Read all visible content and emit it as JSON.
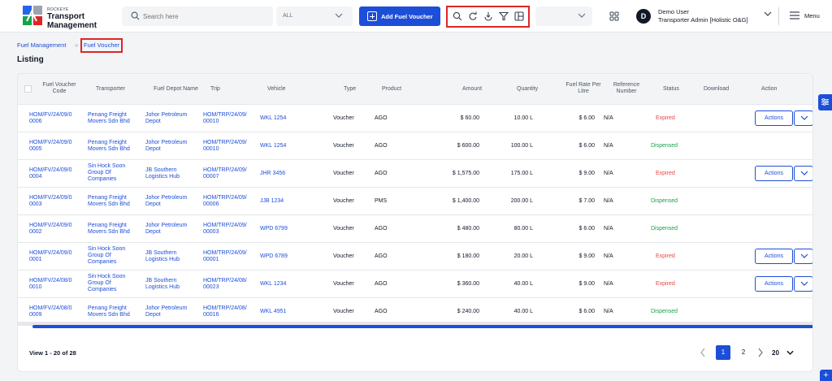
{
  "app": {
    "brand": "ROCKEYE",
    "title_line1": "Transport",
    "title_line2": "Management"
  },
  "header": {
    "search_placeholder": "Search here",
    "filter_value": "ALL",
    "add_button_label": "Add Fuel Voucher",
    "empty_select_value": "",
    "user_name": "Demo User",
    "user_role": "Transporter Admin [Holistic O&G]",
    "avatar_initial": "D",
    "menu_label": "Menu",
    "toolbar_icons": [
      "search-icon",
      "refresh-icon",
      "download-icon",
      "filter-icon",
      "columns-icon"
    ]
  },
  "breadcrumb": {
    "root": "Fuel Management",
    "separator": "»",
    "current": "Fuel Voucher"
  },
  "page_title": "Listing",
  "table": {
    "columns": {
      "code_line1": "Fuel Voucher",
      "code_line2": "Code",
      "transporter": "Transporter",
      "depot": "Fuel Depot Name",
      "trip": "Trip",
      "vehicle": "Vehicle",
      "type": "Type",
      "product": "Product",
      "amount": "Amount",
      "quantity": "Quantity",
      "rate_line1": "Fuel Rate Per",
      "rate_line2": "Litre",
      "ref_line1": "Reference",
      "ref_line2": "Number",
      "status": "Status",
      "download": "Download",
      "action": "Action"
    },
    "rows": [
      {
        "code1": "HOM/FV/24/09/0",
        "code2": "0006",
        "tr1": "Penang Freight",
        "tr2": "Movers Sdn Bhd",
        "tr3": "",
        "dp1": "Johor Petroleum",
        "dp2": "Depot",
        "trip1": "HOM/TRP/24/09/",
        "trip2": "00010",
        "vehicle": "WKL 1254",
        "type": "Voucher",
        "product": "AGO",
        "amount": "$ 60.00",
        "quantity": "10.00 L",
        "rate": "$ 6.00",
        "ref": "N/A",
        "status": "Expired",
        "action": "Actions"
      },
      {
        "code1": "HOM/FV/24/09/0",
        "code2": "0005",
        "tr1": "Penang Freight",
        "tr2": "Movers Sdn Bhd",
        "tr3": "",
        "dp1": "Johor Petroleum",
        "dp2": "Depot",
        "trip1": "HOM/TRP/24/09/",
        "trip2": "00010",
        "vehicle": "WKL 1254",
        "type": "Voucher",
        "product": "AGO",
        "amount": "$ 600.00",
        "quantity": "100.00 L",
        "rate": "$ 6.00",
        "ref": "N/A",
        "status": "Dispensed",
        "action": ""
      },
      {
        "code1": "HOM/FV/24/09/0",
        "code2": "0004",
        "tr1": "Sin Hock Soon",
        "tr2": "Group Of",
        "tr3": "Companies",
        "dp1": "JB Southern",
        "dp2": "Logistics Hub",
        "trip1": "HOM/TRP/24/09/",
        "trip2": "00007",
        "vehicle": "JHR 3456",
        "type": "Voucher",
        "product": "AGO",
        "amount": "$ 1,575.00",
        "quantity": "175.00 L",
        "rate": "$ 9.00",
        "ref": "N/A",
        "status": "Expired",
        "action": "Actions"
      },
      {
        "code1": "HOM/FV/24/09/0",
        "code2": "0003",
        "tr1": "Penang Freight",
        "tr2": "Movers Sdn Bhd",
        "tr3": "",
        "dp1": "Johor Petroleum",
        "dp2": "Depot",
        "trip1": "HOM/TRP/24/09/",
        "trip2": "00006",
        "vehicle": "JJB 1234",
        "type": "Voucher",
        "product": "PMS",
        "amount": "$ 1,400.00",
        "quantity": "200.00 L",
        "rate": "$ 7.00",
        "ref": "N/A",
        "status": "Dispensed",
        "action": ""
      },
      {
        "code1": "HOM/FV/24/09/0",
        "code2": "0002",
        "tr1": "Penang Freight",
        "tr2": "Movers Sdn Bhd",
        "tr3": "",
        "dp1": "Johor Petroleum",
        "dp2": "Depot",
        "trip1": "HOM/TRP/24/09/",
        "trip2": "00003",
        "vehicle": "WPD 6799",
        "type": "Voucher",
        "product": "AGO",
        "amount": "$ 480.00",
        "quantity": "80.00 L",
        "rate": "$ 6.00",
        "ref": "N/A",
        "status": "Dispensed",
        "action": ""
      },
      {
        "code1": "HOM/FV/24/09/0",
        "code2": "0001",
        "tr1": "Sin Hock Soon",
        "tr2": "Group Of",
        "tr3": "Companies",
        "dp1": "JB Southern",
        "dp2": "Logistics Hub",
        "trip1": "HOM/TRP/24/09/",
        "trip2": "00001",
        "vehicle": "WPD 6789",
        "type": "Voucher",
        "product": "AGO",
        "amount": "$ 180.00",
        "quantity": "20.00 L",
        "rate": "$ 9.00",
        "ref": "N/A",
        "status": "Expired",
        "action": "Actions"
      },
      {
        "code1": "HOM/FV/24/08/0",
        "code2": "0010",
        "tr1": "Sin Hock Soon",
        "tr2": "Group Of",
        "tr3": "Companies",
        "dp1": "JB Southern",
        "dp2": "Logistics Hub",
        "trip1": "HOM/TRP/24/08/",
        "trip2": "00023",
        "vehicle": "WKL 1234",
        "type": "Voucher",
        "product": "AGO",
        "amount": "$ 360.00",
        "quantity": "40.00 L",
        "rate": "$ 9.00",
        "ref": "N/A",
        "status": "Expired",
        "action": "Actions"
      },
      {
        "code1": "HOM/FV/24/08/0",
        "code2": "0009",
        "tr1": "Penang Freight",
        "tr2": "Movers Sdn Bhd",
        "tr3": "",
        "dp1": "Johor Petroleum",
        "dp2": "Depot",
        "trip1": "HOM/TRP/24/08/",
        "trip2": "00016",
        "vehicle": "WKL 4951",
        "type": "Voucher",
        "product": "AGO",
        "amount": "$ 240.00",
        "quantity": "40.00 L",
        "rate": "$ 6.00",
        "ref": "N/A",
        "status": "Dispensed",
        "action": ""
      }
    ]
  },
  "footer": {
    "view_text": "View 1 - 20 of 28",
    "pages": [
      "1",
      "2"
    ],
    "current_page": "1",
    "page_size": "20"
  },
  "colors": {
    "accent": "#1d4ed8",
    "expired": "#ef4444",
    "dispensed": "#16a34a",
    "highlight_border": "#dc2626"
  }
}
